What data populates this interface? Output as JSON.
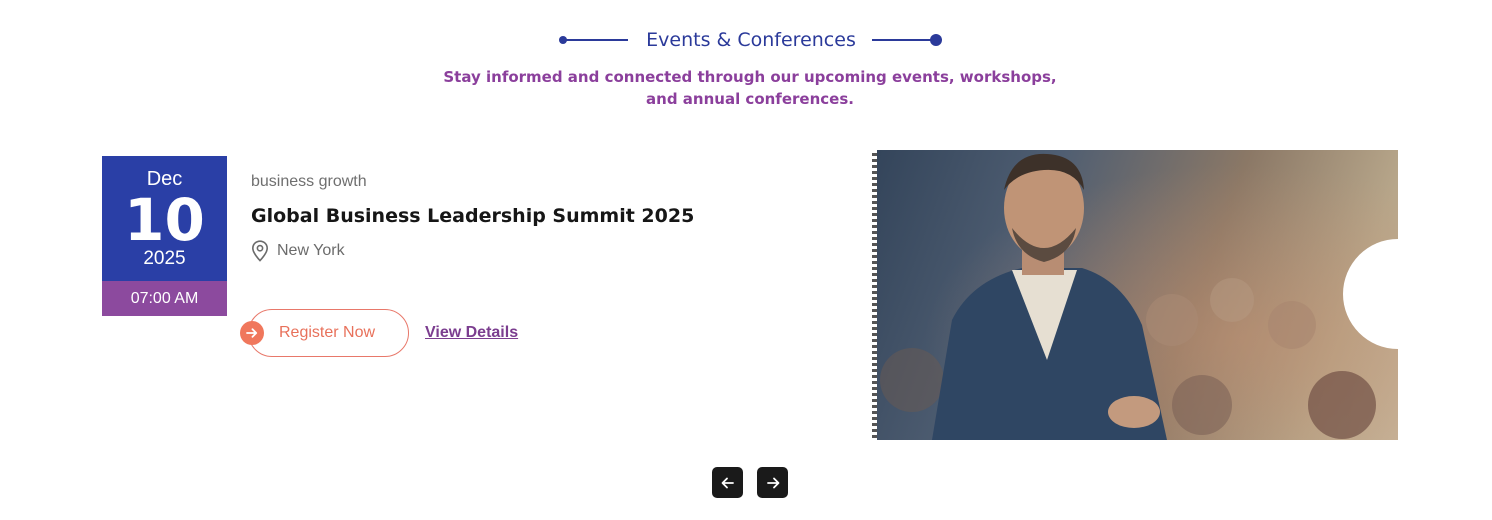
{
  "section": {
    "title": "Events & Conferences",
    "subtitle": "Stay informed and connected through our upcoming events, workshops, and annual conferences."
  },
  "event": {
    "month": "Dec",
    "day": "10",
    "year": "2025",
    "time": "07:00 AM",
    "category": "business growth",
    "title": "Global Business Leadership Summit 2025",
    "location": "New York",
    "register_label": "Register Now",
    "details_label": "View Details"
  },
  "icons": {
    "location": "map-pin-icon",
    "register_arrow": "arrow-right-icon",
    "prev": "arrow-left-icon",
    "next": "arrow-right-icon"
  },
  "colors": {
    "primary_blue": "#2a3fa6",
    "accent_purple": "#8c4a9e",
    "accent_orange": "#f0775c"
  }
}
